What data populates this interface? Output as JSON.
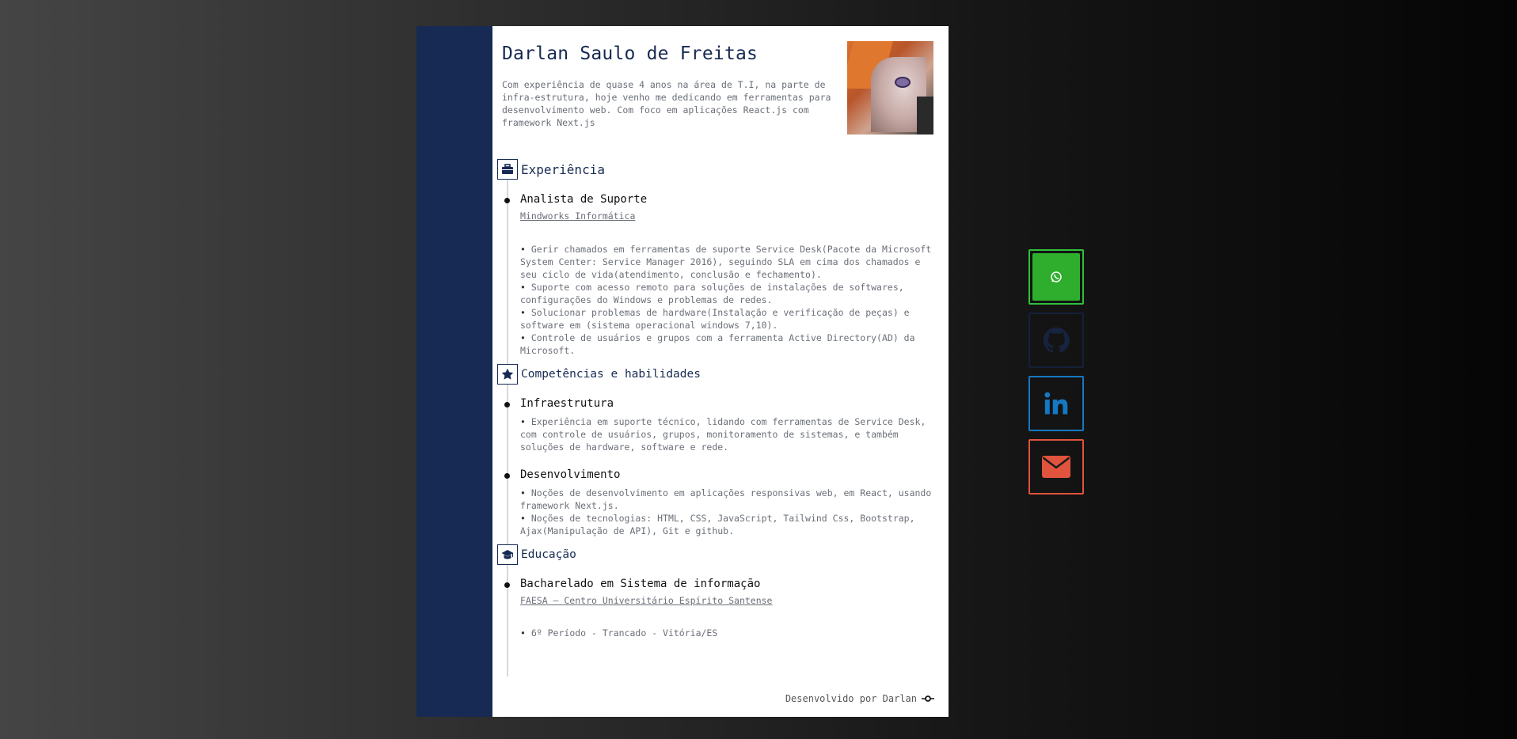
{
  "profile": {
    "name": "Darlan Saulo de Freitas",
    "summary": "Com experiência de quase 4 anos na área de T.I, na parte de infra-estrutura, hoje venho me dedicando em ferramentas para desenvolvimento web. Com foco em aplicações React.js com framework Next.js"
  },
  "experience": {
    "title": "Experiência",
    "icon": "briefcase-icon",
    "jobs": [
      {
        "title": "Analista de Suporte",
        "company": "Mindworks Informática",
        "bullets": [
          "Gerir chamados em ferramentas de suporte Service Desk(Pacote da Microsoft System Center: Service Manager 2016), seguindo SLA em cima dos chamados e seu ciclo de vida(atendimento, conclusão e fechamento).",
          "Suporte com acesso remoto para soluções de instalações de softwares, configurações do Windows e problemas de redes.",
          "Solucionar problemas de hardware(Instalação e verificação de peças) e software em (sistema operacional windows 7,10).",
          "Controle de usuários e grupos com a ferramenta Active Directory(AD) da Microsoft."
        ]
      }
    ]
  },
  "skills": {
    "title": "Competências e habilidades",
    "icon": "star-icon",
    "items": [
      {
        "title": "Infraestrutura",
        "bullets": [
          "Experiência em suporte técnico, lidando com ferramentas de Service Desk, com controle de usuários, grupos, monitoramento de sistemas, e também soluções de hardware, software e rede."
        ]
      },
      {
        "title": "Desenvolvimento",
        "bullets": [
          "Noções de desenvolvimento em aplicações responsivas web, em React, usando framework Next.js.",
          "Noções de tecnologias: HTML, CSS, JavaScript, Tailwind Css, Bootstrap, Ajax(Manipulação de API), Git e github."
        ]
      }
    ]
  },
  "education": {
    "title": "Educação",
    "icon": "graduation-cap-icon",
    "items": [
      {
        "title": "Bacharelado em Sistema de informação",
        "institution": "FAESA – Centro Universitário Espírito Santense",
        "bullets": [
          "6º Período - Trancado - Vitória/ES"
        ]
      }
    ]
  },
  "footer": {
    "text": "Desenvolvido por Darlan",
    "icon": "commit-icon"
  },
  "social": [
    {
      "name": "whatsapp",
      "icon": "whatsapp-icon",
      "color": "#2fae2d"
    },
    {
      "name": "github",
      "icon": "github-icon",
      "color": "#15203a"
    },
    {
      "name": "linkedin",
      "icon": "linkedin-icon",
      "color": "#1678c2"
    },
    {
      "name": "email",
      "icon": "envelope-icon",
      "color": "#e0533c"
    }
  ],
  "colors": {
    "sidebar": "#172a53",
    "accent": "#172a53"
  }
}
